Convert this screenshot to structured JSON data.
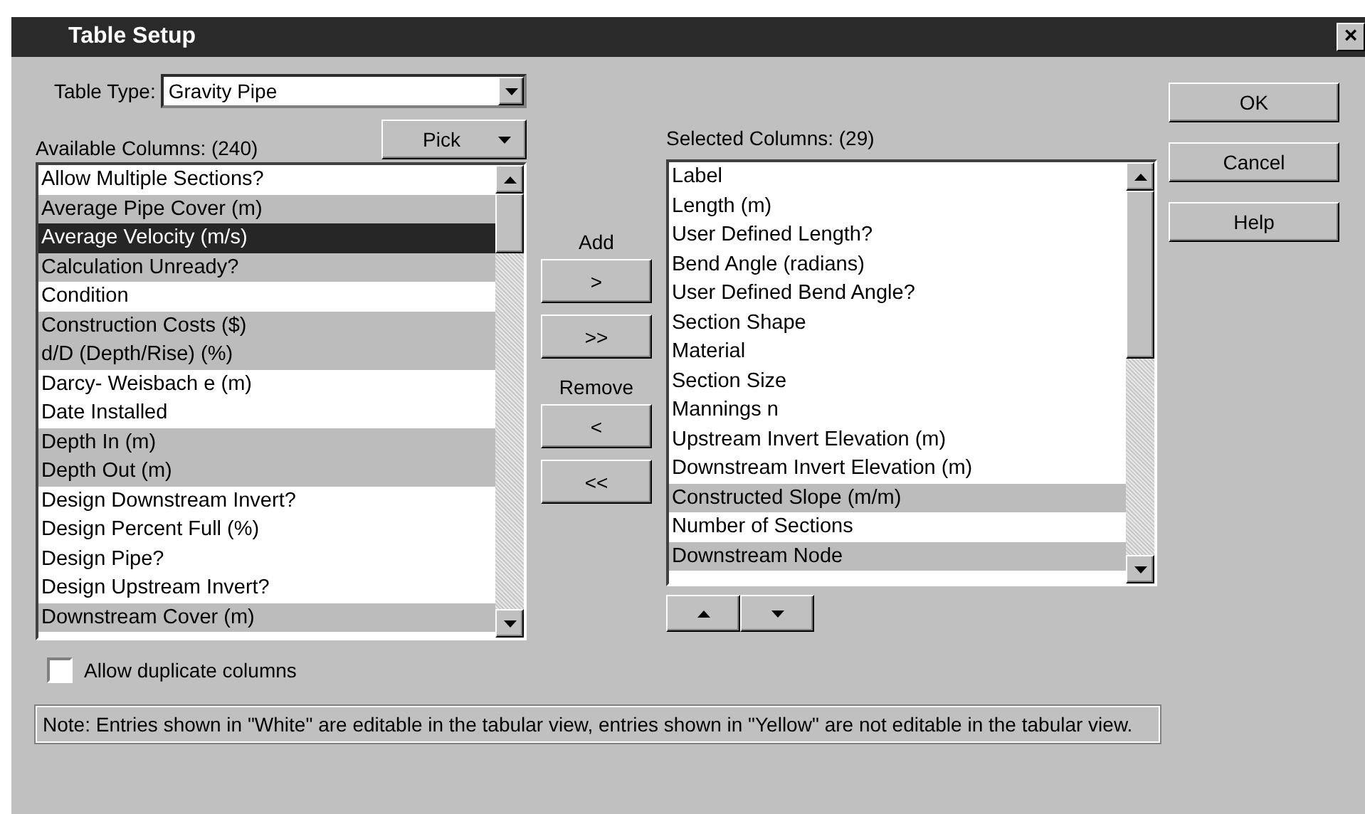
{
  "window": {
    "title": "Table Setup",
    "close": "×"
  },
  "table_type": {
    "label": "Table Type:",
    "value": "Gravity Pipe"
  },
  "available": {
    "label": "Available Columns: (240)",
    "pick_button": "Pick",
    "items": [
      {
        "text": "Allow Multiple Sections?",
        "editable": true,
        "selected": false
      },
      {
        "text": "Average Pipe Cover (m)",
        "editable": false,
        "selected": false
      },
      {
        "text": "Average Velocity (m/s)",
        "selected": true
      },
      {
        "text": "Calculation Unready?",
        "editable": false,
        "selected": false
      },
      {
        "text": "Condition",
        "editable": true,
        "selected": false
      },
      {
        "text": "Construction Costs ($)",
        "editable": false,
        "selected": false
      },
      {
        "text": "d/D (Depth/Rise) (%)",
        "editable": false,
        "selected": false
      },
      {
        "text": "Darcy- Weisbach e (m)",
        "editable": true,
        "selected": false
      },
      {
        "text": "Date Installed",
        "editable": true,
        "selected": false
      },
      {
        "text": "Depth In (m)",
        "editable": false,
        "selected": false
      },
      {
        "text": "Depth Out (m)",
        "editable": false,
        "selected": false
      },
      {
        "text": "Design Downstream Invert?",
        "editable": true,
        "selected": false
      },
      {
        "text": "Design Percent Full (%)",
        "editable": true,
        "selected": false
      },
      {
        "text": "Design Pipe?",
        "editable": true,
        "selected": false
      },
      {
        "text": "Design Upstream Invert?",
        "editable": true,
        "selected": false
      },
      {
        "text": "Downstream Cover (m)",
        "editable": false,
        "selected": false
      }
    ]
  },
  "transfer": {
    "add_label": "Add",
    "add_buttons": [
      ">",
      ">>"
    ],
    "remove_label": "Remove",
    "remove_buttons": [
      "<",
      "<<"
    ]
  },
  "selected": {
    "label": "Selected Columns: (29)",
    "items": [
      {
        "text": "Label",
        "editable": true,
        "selected": false
      },
      {
        "text": "Length (m)",
        "editable": true,
        "selected": false
      },
      {
        "text": "User Defined Length?",
        "editable": true,
        "selected": false
      },
      {
        "text": "Bend Angle (radians)",
        "editable": true,
        "selected": false
      },
      {
        "text": "User Defined Bend Angle?",
        "editable": true,
        "selected": false
      },
      {
        "text": "Section Shape",
        "editable": true,
        "selected": false
      },
      {
        "text": "Material",
        "editable": true,
        "selected": false
      },
      {
        "text": "Section Size",
        "editable": true,
        "selected": false
      },
      {
        "text": "Mannings n",
        "editable": true,
        "selected": false
      },
      {
        "text": "Upstream Invert Elevation (m)",
        "editable": true,
        "selected": false
      },
      {
        "text": "Downstream Invert Elevation (m)",
        "editable": true,
        "selected": false
      },
      {
        "text": "Constructed Slope (m/m)",
        "editable": false,
        "selected": false
      },
      {
        "text": "Number of Sections",
        "editable": true,
        "selected": false
      },
      {
        "text": "Downstream Node",
        "editable": false,
        "selected": false
      }
    ]
  },
  "dialog_buttons": [
    "OK",
    "Cancel",
    "Help"
  ],
  "allow_duplicates": {
    "label": "Allow duplicate columns",
    "checked": false
  },
  "note": "Note: Entries shown in \"White\" are editable in the tabular view, entries shown in \"Yellow\" are not editable in the tabular view."
}
